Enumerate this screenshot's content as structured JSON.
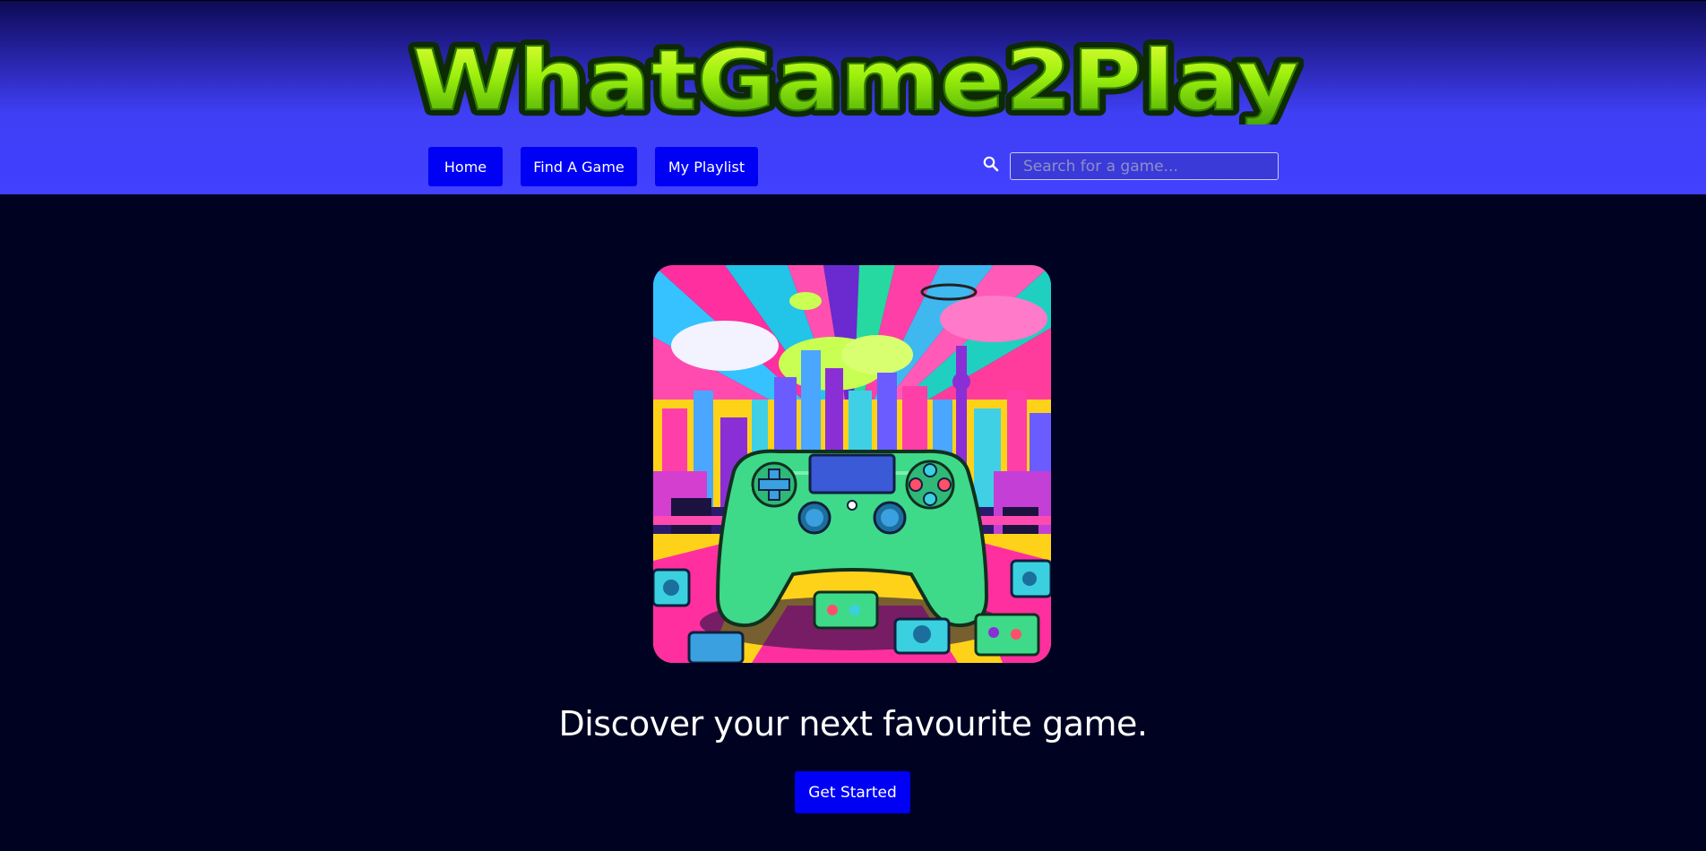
{
  "header": {
    "logo_text": "WhatGame2Play",
    "nav": [
      {
        "label": "Home"
      },
      {
        "label": "Find A Game"
      },
      {
        "label": "My Playlist"
      }
    ],
    "search": {
      "placeholder": "Search for a game...",
      "value": "",
      "icon": "search-icon"
    }
  },
  "hero": {
    "image": "game-controller-city-illustration",
    "tagline": "Discover your next favourite game.",
    "cta_label": "Get Started"
  },
  "colors": {
    "background": "#000222",
    "header_blue": "#4141ff",
    "button_blue": "#0000f5",
    "logo_green": "#8ef00a"
  }
}
